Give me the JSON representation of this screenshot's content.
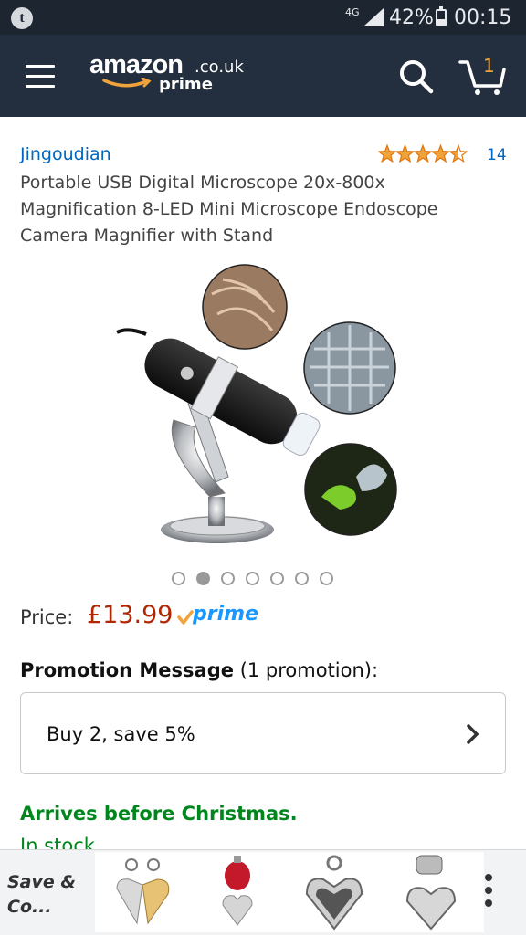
{
  "status_bar": {
    "app_badge": "t",
    "network": "4G",
    "battery_percent": "42%",
    "battery_level": 0.42,
    "time": "00:15"
  },
  "header": {
    "logo_word": "amazon",
    "logo_tld": ".co.uk",
    "logo_sub": "prime",
    "cart_count": "1",
    "icons": [
      "menu-icon",
      "search-icon",
      "cart-icon"
    ]
  },
  "product": {
    "brand": "Jingoudian",
    "rating": 4.5,
    "review_count": "14",
    "title": "Portable USB Digital Microscope 20x-800x Magnification 8-LED Mini Microscope Endoscope Camera Magnifier with Stand",
    "image_count": 7,
    "active_image_index": 1,
    "price_label": "Price:",
    "price": "£13.99",
    "prime_label": "prime"
  },
  "promotion": {
    "heading": "Promotion Message",
    "count_text": "(1 promotion):",
    "text": "Buy 2, save 5%"
  },
  "delivery": {
    "arrives": "Arrives before Christmas.",
    "stock": "In stock."
  },
  "bottom_strip": {
    "label": "Save & Co..."
  },
  "colors": {
    "header_bg": "#232f3e",
    "link_blue": "#0066c0",
    "price_red": "#b12704",
    "prime_blue": "#1a98ff",
    "green": "#00861c",
    "star_orange": "#f0a23b"
  }
}
